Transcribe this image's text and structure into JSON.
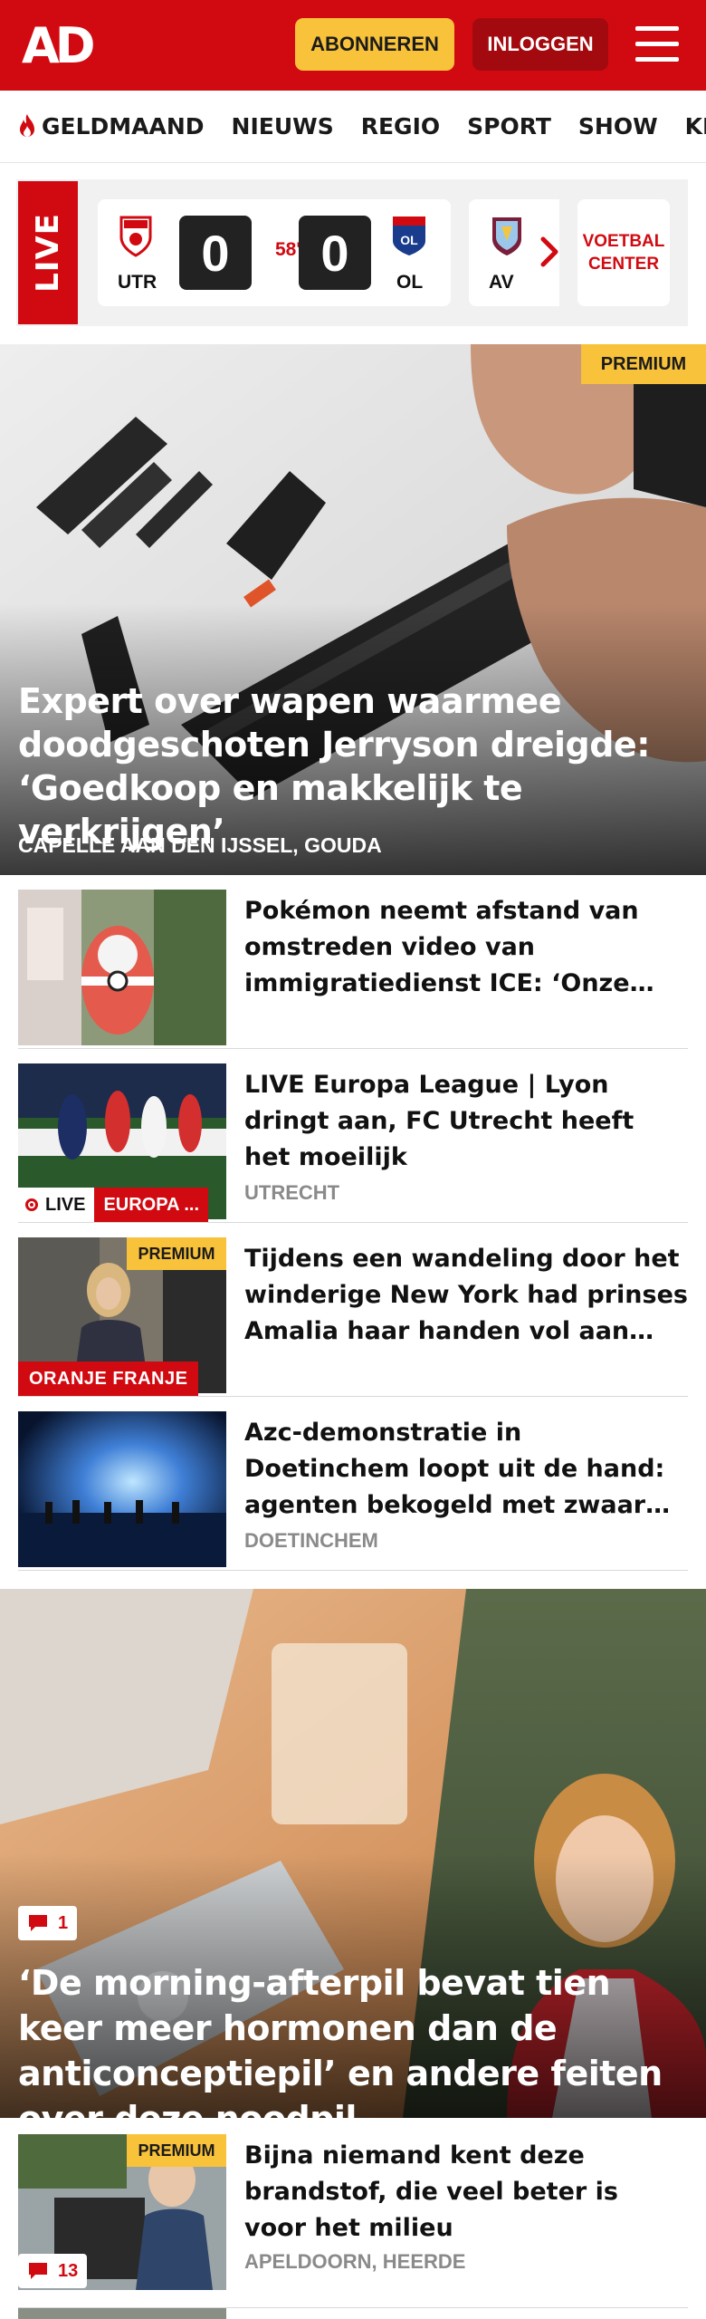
{
  "header": {
    "logo": "AD",
    "subscribe_label": "ABONNEREN",
    "login_label": "INLOGGEN"
  },
  "nav": {
    "items": [
      "GELDMAAND",
      "NIEUWS",
      "REGIO",
      "SPORT",
      "SHOW",
      "KIJK"
    ]
  },
  "live_widget": {
    "tag": "LIVE",
    "match": {
      "home_code": "UTR",
      "away_code": "OL",
      "home_score": "0",
      "away_score": "0",
      "minute": "58'"
    },
    "next_match_code": "AV",
    "center_label": "VOETBAL CENTER"
  },
  "hero": {
    "badge": "PREMIUM",
    "title": "Expert over wapen waarmee doodgeschoten Jerryson dreigde: ‘Goedkoop en makkelijk te verkrijgen’",
    "location": "CAPELLE AAN DEN IJSSEL, GOUDA"
  },
  "articles": [
    {
      "title": "Pokémon neemt afstand van omstreden video van immigratiedienst ICE: ‘Onze beelden zijn…",
      "location": ""
    },
    {
      "title": "LIVE Europa League | Lyon dringt aan, FC Utrecht heeft het moeilijk",
      "location": "UTRECHT",
      "live_label": "LIVE",
      "tag": "EUROPA ..."
    },
    {
      "title": "Tijdens een wandeling door het winderige New York had prinses Amalia haar handen vol aan haa…",
      "location": "",
      "badge": "PREMIUM",
      "tag": "ORANJE FRANJE"
    },
    {
      "title": "Azc-demonstratie in Doetinchem loopt uit de hand: agenten bekogeld met zwaar vuurwerk,…",
      "location": "DOETINCHEM"
    }
  ],
  "hero2": {
    "comments": "1",
    "title": "‘De morning-afterpil bevat tien keer meer hormonen dan de anticonceptiepil’ en andere feiten over deze noodpil"
  },
  "article5": {
    "title": "Bijna niemand kent deze brandstof, die veel beter is voor het milieu",
    "location": "APELDOORN, HEERDE",
    "badge": "PREMIUM",
    "comments": "13"
  },
  "colors": {
    "brand_red": "#d10a11",
    "premium_yellow": "#f8c23a",
    "login_dark_red": "#a30a0f"
  }
}
